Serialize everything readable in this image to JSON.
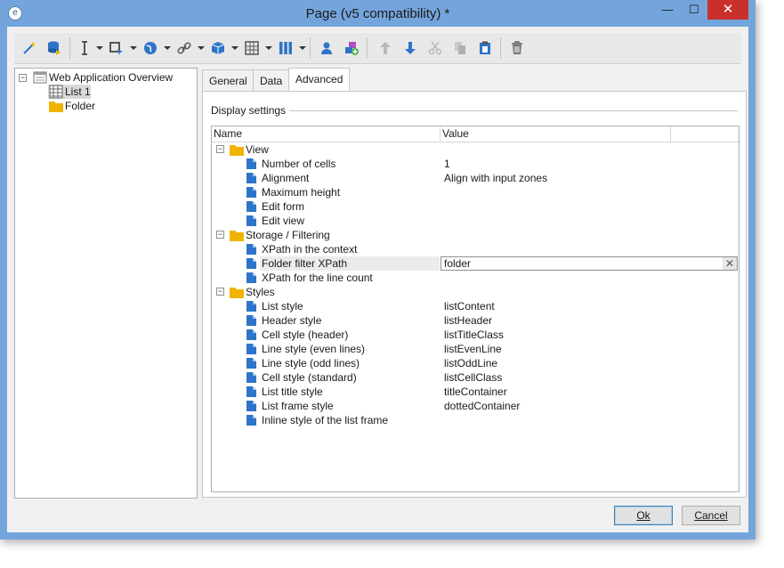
{
  "window": {
    "title": "Page (v5 compatibility) *",
    "min_label": "—",
    "max_label": "☐",
    "close_label": "✕"
  },
  "toolbar": {
    "items": [
      "wand-icon",
      "database-icon",
      "text-cursor-icon",
      "form-field-icon",
      "globe-icon",
      "link-icon",
      "package-icon",
      "table-icon",
      "columns-icon",
      "user-icon",
      "add-component-icon",
      "arrow-up-icon",
      "arrow-down-icon",
      "cut-icon",
      "copy-icon",
      "paste-icon",
      "trash-icon"
    ]
  },
  "tree": {
    "root": "Web Application Overview",
    "children": [
      "List 1",
      "Folder"
    ]
  },
  "tabs": [
    {
      "label": "General"
    },
    {
      "label": "Data"
    },
    {
      "label": "Advanced"
    }
  ],
  "panel": {
    "group_label": "Display settings"
  },
  "grid": {
    "columns": [
      "Name",
      "Value"
    ],
    "groups": [
      {
        "label": "View",
        "rows": [
          {
            "name": "Number of cells",
            "value": "1"
          },
          {
            "name": "Alignment",
            "value": "Align with input zones"
          },
          {
            "name": "Maximum height",
            "value": ""
          },
          {
            "name": "Edit form",
            "value": ""
          },
          {
            "name": "Edit view",
            "value": ""
          }
        ]
      },
      {
        "label": "Storage / Filtering",
        "rows": [
          {
            "name": "XPath in the context",
            "value": ""
          },
          {
            "name": "Folder filter XPath",
            "value": "folder"
          },
          {
            "name": "XPath for the line count",
            "value": ""
          }
        ]
      },
      {
        "label": "Styles",
        "rows": [
          {
            "name": "List style",
            "value": "listContent"
          },
          {
            "name": "Header style",
            "value": "listHeader"
          },
          {
            "name": "Cell style (header)",
            "value": "listTitleClass"
          },
          {
            "name": "Line style (even lines)",
            "value": "listEvenLine"
          },
          {
            "name": "Line style (odd lines)",
            "value": "listOddLine"
          },
          {
            "name": "Cell style (standard)",
            "value": "listCellClass"
          },
          {
            "name": "List title style",
            "value": "titleContainer"
          },
          {
            "name": "List frame style",
            "value": "dottedContainer"
          },
          {
            "name": "Inline style of the list frame",
            "value": ""
          }
        ]
      }
    ]
  },
  "buttons": {
    "ok": "Ok",
    "cancel": "Cancel"
  },
  "colors": {
    "folder": "#f0b400",
    "accent": "#2e74c9",
    "window_border": "#73a5dc",
    "close": "#c9302c"
  }
}
